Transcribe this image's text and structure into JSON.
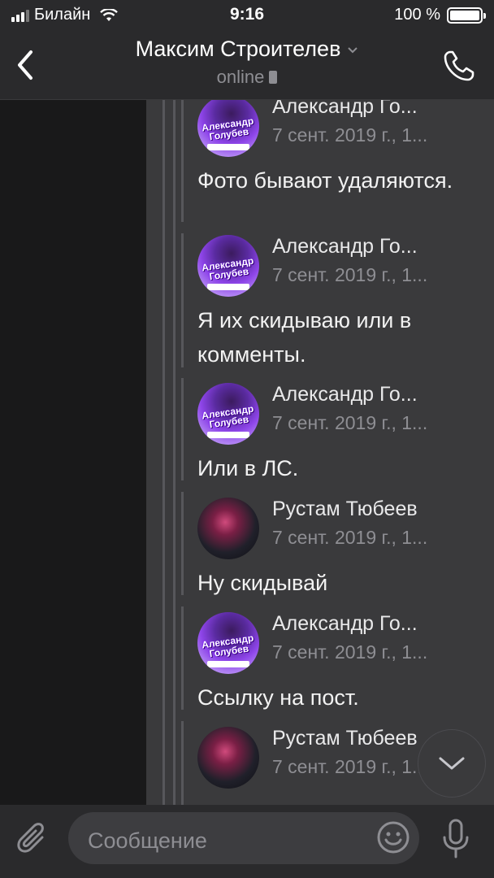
{
  "status_bar": {
    "carrier": "Билайн",
    "time": "9:16",
    "battery": "100 %"
  },
  "header": {
    "title": "Максим Строителев",
    "status": "online"
  },
  "messages": [
    {
      "author": "Александр Го...",
      "date": "7 сент. 2019 г., 1...",
      "text": "Фото бывают удаляются.",
      "avatar": "aleksandr-golubev"
    },
    {
      "author": "Александр Го...",
      "date": "7 сент. 2019 г., 1...",
      "text": "Я их скидываю или в комменты.",
      "avatar": "aleksandr-golubev"
    },
    {
      "author": "Александр Го...",
      "date": "7 сент. 2019 г., 1...",
      "text": "Или в ЛС.",
      "avatar": "aleksandr-golubev"
    },
    {
      "author": "Рустам Тюбеев",
      "date": "7 сент. 2019 г., 1...",
      "text": "Ну скидывай",
      "avatar": "rustam-tyubeev"
    },
    {
      "author": "Александр Го...",
      "date": "7 сент. 2019 г., 1...",
      "text": "Ссылку на пост.",
      "avatar": "aleksandr-golubev"
    },
    {
      "author": "Рустам Тюбеев",
      "date": "7 сент. 2019 г., 1...",
      "text": "",
      "avatar": "rustam-tyubeev"
    }
  ],
  "avatar_text": {
    "line1": "Александр",
    "line2": "Голубев"
  },
  "composer": {
    "placeholder": "Сообщение"
  },
  "colors": {
    "background": "#19191a",
    "bar": "#2a2a2c",
    "bubble": "#3a3a3c",
    "text": "#e9e9ea",
    "secondary": "#8e8e93"
  },
  "icons": [
    "back-arrow-icon",
    "chevron-down-icon",
    "phone-call-icon",
    "scroll-down-icon",
    "paperclip-icon",
    "emoji-icon",
    "microphone-icon"
  ]
}
